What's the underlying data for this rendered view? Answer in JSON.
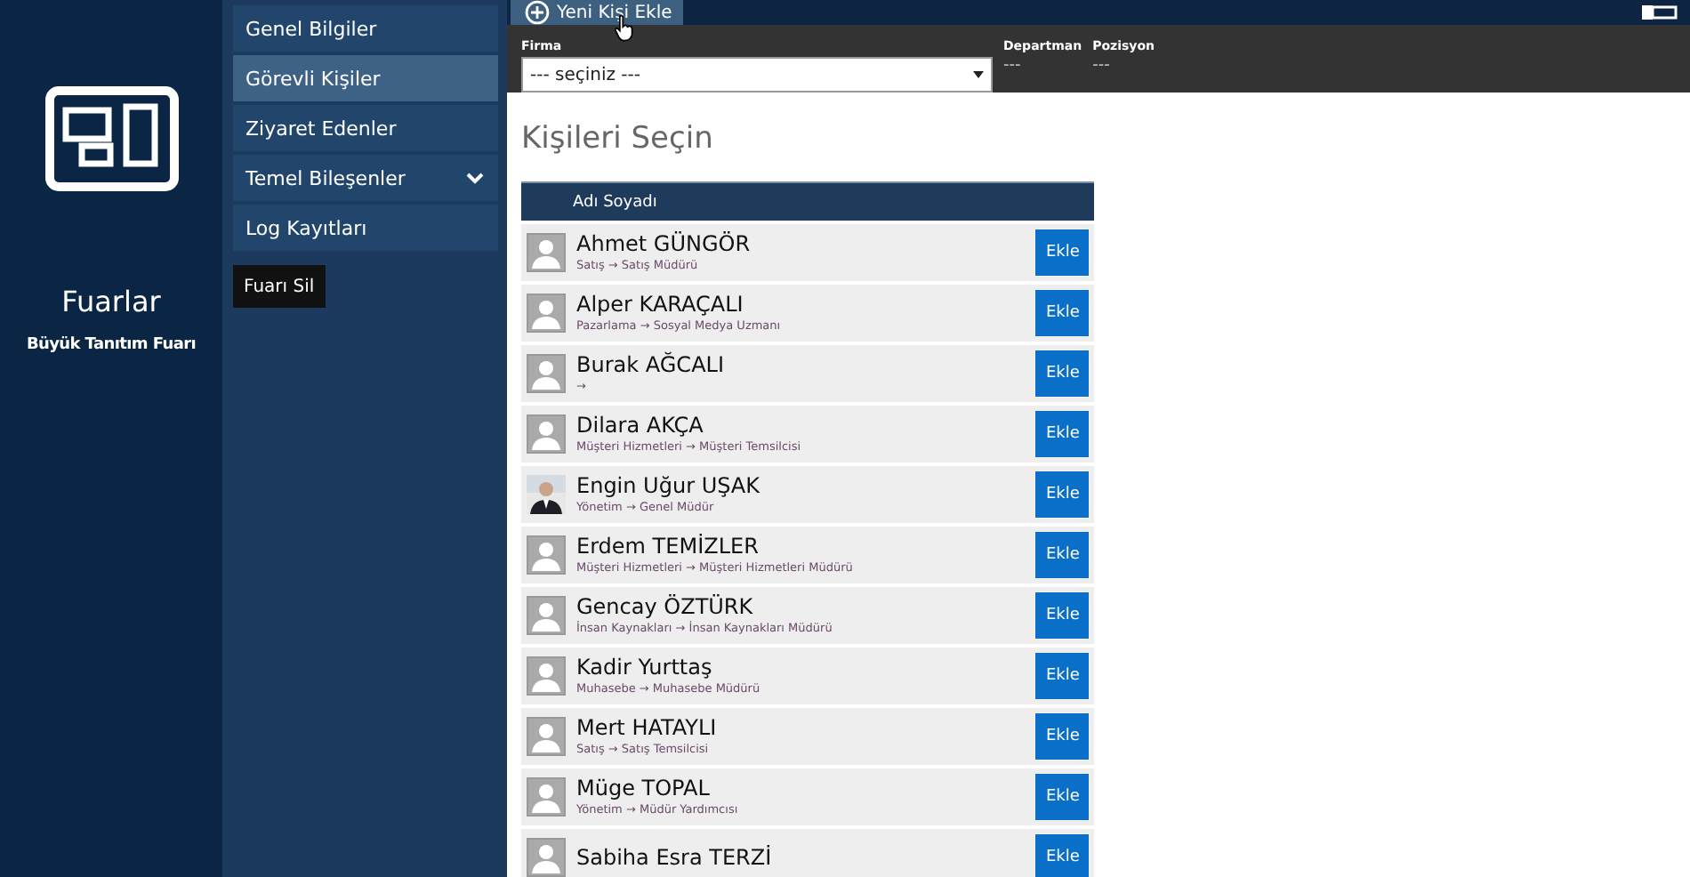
{
  "app": {
    "title": "Fuarlar",
    "subtitle": "Büyük Tanıtım Fuarı"
  },
  "nav": {
    "items": [
      {
        "label": "Genel Bilgiler",
        "selected": false,
        "expandable": false
      },
      {
        "label": "Görevli Kişiler",
        "selected": true,
        "expandable": false
      },
      {
        "label": "Ziyaret Edenler",
        "selected": false,
        "expandable": false
      },
      {
        "label": "Temel Bileşenler",
        "selected": false,
        "expandable": true
      },
      {
        "label": "Log Kayıtları",
        "selected": false,
        "expandable": false
      }
    ],
    "delete_button": "Fuarı Sil"
  },
  "toolbar": {
    "new_button": "Yeni Kişi Ekle"
  },
  "filters": {
    "firma": {
      "label": "Firma",
      "value": "--- seçiniz ---"
    },
    "departman": {
      "label": "Departman",
      "value": "---"
    },
    "pozisyon": {
      "label": "Pozisyon",
      "value": "---"
    }
  },
  "heading": "Kişileri Seçin",
  "table": {
    "columns": [
      "Adı Soyadı"
    ],
    "rows": [
      {
        "name": "Ahmet GÜNGÖR",
        "detail": "Satış → Satış Müdürü",
        "kind": "placeholder",
        "action": "Ekle"
      },
      {
        "name": "Alper KARAÇALI",
        "detail": "Pazarlama → Sosyal Medya Uzmanı",
        "kind": "placeholder",
        "action": "Ekle"
      },
      {
        "name": "Burak AĞCALI",
        "detail": "→",
        "kind": "placeholder",
        "action": "Ekle"
      },
      {
        "name": "Dilara AKÇA",
        "detail": "Müşteri Hizmetleri → Müşteri Temsilcisi",
        "kind": "placeholder",
        "action": "Ekle"
      },
      {
        "name": "Engin Uğur UŞAK",
        "detail": "Yönetim → Genel Müdür",
        "action": "Ekle"
      },
      {
        "name": "Erdem TEMİZLER",
        "detail": "Müşteri Hizmetleri → Müşteri Hizmetleri Müdürü",
        "kind": "placeholder",
        "action": "Ekle"
      },
      {
        "name": "Gencay ÖZTÜRK",
        "detail": "İnsan Kaynakları → İnsan Kaynakları Müdürü",
        "kind": "placeholder",
        "action": "Ekle"
      },
      {
        "name": "Kadir Yurttaş",
        "detail": "Muhasebe → Muhasebe Müdürü",
        "kind": "placeholder",
        "action": "Ekle"
      },
      {
        "name": "Mert HATAYLI",
        "detail": "Satış → Satış Temsilcisi",
        "kind": "placeholder",
        "action": "Ekle"
      },
      {
        "name": "Müge TOPAL",
        "detail": "Yönetim → Müdür Yardımcısı",
        "kind": "placeholder",
        "action": "Ekle"
      },
      {
        "name": "Sabiha Esra TERZİ",
        "kind": "placeholder",
        "action": "Ekle"
      }
    ]
  }
}
